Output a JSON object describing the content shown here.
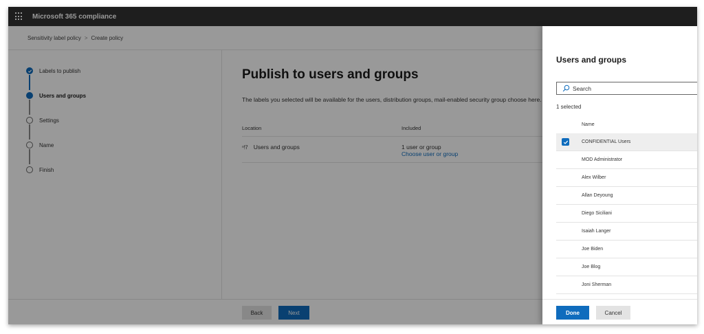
{
  "app": {
    "title": "Microsoft 365 compliance"
  },
  "breadcrumb": {
    "items": [
      "Sensitivity label policy",
      "Create policy"
    ],
    "separator": ">"
  },
  "wizard": {
    "steps": [
      {
        "label": "Labels to publish",
        "state": "done"
      },
      {
        "label": "Users and groups",
        "state": "current"
      },
      {
        "label": "Settings",
        "state": "pending"
      },
      {
        "label": "Name",
        "state": "pending"
      },
      {
        "label": "Finish",
        "state": "pending"
      }
    ]
  },
  "content": {
    "title": "Publish to users and groups",
    "description": "The labels you selected will be available for the users, distribution groups, mail-enabled security group choose here.",
    "table": {
      "headers": {
        "location": "Location",
        "included": "Included"
      },
      "rows": [
        {
          "location": "Users and groups",
          "included": "1 user or group",
          "link": "Choose user or group"
        }
      ]
    }
  },
  "footer": {
    "back": "Back",
    "next": "Next"
  },
  "panel": {
    "title": "Users and groups",
    "search_placeholder": "Search",
    "selected_count": "1 selected",
    "column_name": "Name",
    "items": [
      {
        "name": "CONFIDENTIAL Users",
        "selected": true
      },
      {
        "name": "MOD Administrator",
        "selected": false
      },
      {
        "name": "Alex Wilber",
        "selected": false
      },
      {
        "name": "Allan Deyoung",
        "selected": false
      },
      {
        "name": "Diego Siciliani",
        "selected": false
      },
      {
        "name": "Isaiah Langer",
        "selected": false
      },
      {
        "name": "Joe Biden",
        "selected": false
      },
      {
        "name": "Joe Blog",
        "selected": false
      },
      {
        "name": "Joni Sherman",
        "selected": false
      }
    ],
    "done": "Done",
    "cancel": "Cancel"
  },
  "colors": {
    "accent": "#0f6cbd",
    "topbar": "#333333"
  }
}
